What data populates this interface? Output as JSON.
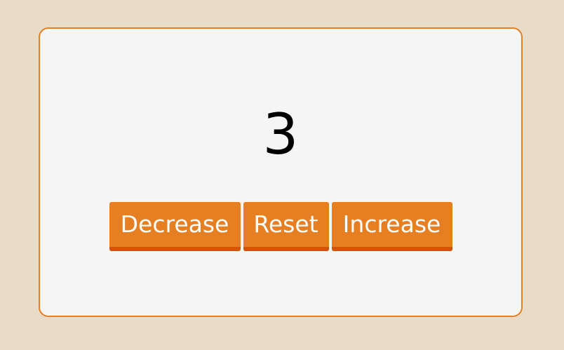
{
  "counter": {
    "value": "3"
  },
  "buttons": {
    "decrease_label": "Decrease",
    "reset_label": "Reset",
    "increase_label": "Increase"
  },
  "colors": {
    "background": "#e8dcc8",
    "card": "#f5f5f5",
    "accent": "#e67e22",
    "accent_shadow": "#d35400"
  }
}
